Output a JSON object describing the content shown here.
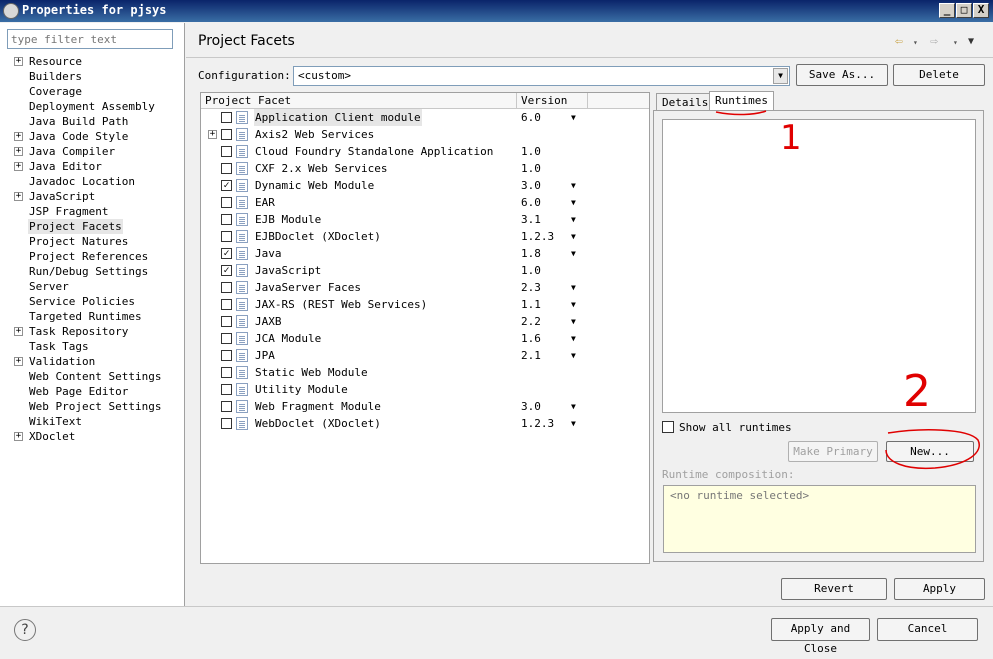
{
  "window": {
    "title": "Properties for pjsys",
    "minimize": "_",
    "maximize": "□",
    "close": "X"
  },
  "filter": {
    "placeholder": "type filter text"
  },
  "tree": [
    {
      "label": "Resource",
      "expandable": true
    },
    {
      "label": "Builders",
      "expandable": false
    },
    {
      "label": "Coverage",
      "expandable": false
    },
    {
      "label": "Deployment Assembly",
      "expandable": false
    },
    {
      "label": "Java Build Path",
      "expandable": false
    },
    {
      "label": "Java Code Style",
      "expandable": true
    },
    {
      "label": "Java Compiler",
      "expandable": true
    },
    {
      "label": "Java Editor",
      "expandable": true
    },
    {
      "label": "Javadoc Location",
      "expandable": false
    },
    {
      "label": "JavaScript",
      "expandable": true
    },
    {
      "label": "JSP Fragment",
      "expandable": false
    },
    {
      "label": "Project Facets",
      "expandable": false,
      "selected": true
    },
    {
      "label": "Project Natures",
      "expandable": false
    },
    {
      "label": "Project References",
      "expandable": false
    },
    {
      "label": "Run/Debug Settings",
      "expandable": false
    },
    {
      "label": "Server",
      "expandable": false
    },
    {
      "label": "Service Policies",
      "expandable": false
    },
    {
      "label": "Targeted Runtimes",
      "expandable": false
    },
    {
      "label": "Task Repository",
      "expandable": true
    },
    {
      "label": "Task Tags",
      "expandable": false
    },
    {
      "label": "Validation",
      "expandable": true
    },
    {
      "label": "Web Content Settings",
      "expandable": false
    },
    {
      "label": "Web Page Editor",
      "expandable": false
    },
    {
      "label": "Web Project Settings",
      "expandable": false
    },
    {
      "label": "WikiText",
      "expandable": false
    },
    {
      "label": "XDoclet",
      "expandable": true
    }
  ],
  "page": {
    "title": "Project Facets"
  },
  "config": {
    "label": "Configuration:",
    "value": "<custom>",
    "save_as": "Save As...",
    "delete": "Delete"
  },
  "facets": {
    "col_facet": "Project Facet",
    "col_version": "Version",
    "rows": [
      {
        "name": "Application Client module",
        "version": "6.0",
        "dropdown": true,
        "checked": false,
        "selected": true,
        "expandable": false
      },
      {
        "name": "Axis2 Web Services",
        "version": "",
        "dropdown": false,
        "checked": false,
        "expandable": true
      },
      {
        "name": "Cloud Foundry Standalone Application",
        "version": "1.0",
        "dropdown": false,
        "checked": false,
        "expandable": false
      },
      {
        "name": "CXF 2.x Web Services",
        "version": "1.0",
        "dropdown": false,
        "checked": false,
        "expandable": false
      },
      {
        "name": "Dynamic Web Module",
        "version": "3.0",
        "dropdown": true,
        "checked": true,
        "expandable": false
      },
      {
        "name": "EAR",
        "version": "6.0",
        "dropdown": true,
        "checked": false,
        "expandable": false
      },
      {
        "name": "EJB Module",
        "version": "3.1",
        "dropdown": true,
        "checked": false,
        "expandable": false
      },
      {
        "name": "EJBDoclet (XDoclet)",
        "version": "1.2.3",
        "dropdown": true,
        "checked": false,
        "expandable": false
      },
      {
        "name": "Java",
        "version": "1.8",
        "dropdown": true,
        "checked": true,
        "expandable": false
      },
      {
        "name": "JavaScript",
        "version": "1.0",
        "dropdown": false,
        "checked": true,
        "expandable": false
      },
      {
        "name": "JavaServer Faces",
        "version": "2.3",
        "dropdown": true,
        "checked": false,
        "expandable": false
      },
      {
        "name": "JAX-RS (REST Web Services)",
        "version": "1.1",
        "dropdown": true,
        "checked": false,
        "expandable": false
      },
      {
        "name": "JAXB",
        "version": "2.2",
        "dropdown": true,
        "checked": false,
        "expandable": false
      },
      {
        "name": "JCA Module",
        "version": "1.6",
        "dropdown": true,
        "checked": false,
        "expandable": false
      },
      {
        "name": "JPA",
        "version": "2.1",
        "dropdown": true,
        "checked": false,
        "expandable": false
      },
      {
        "name": "Static Web Module",
        "version": "",
        "dropdown": false,
        "checked": false,
        "expandable": false
      },
      {
        "name": "Utility Module",
        "version": "",
        "dropdown": false,
        "checked": false,
        "expandable": false
      },
      {
        "name": "Web Fragment Module",
        "version": "3.0",
        "dropdown": true,
        "checked": false,
        "expandable": false
      },
      {
        "name": "WebDoclet (XDoclet)",
        "version": "1.2.3",
        "dropdown": true,
        "checked": false,
        "expandable": false
      }
    ]
  },
  "tabs": {
    "details": "Details",
    "runtimes": "Runtimes"
  },
  "runtimes": {
    "show_all": "Show all runtimes",
    "make_primary": "Make Primary",
    "new": "New...",
    "composition_label": "Runtime composition:",
    "composition_value": "<no runtime selected>"
  },
  "actions": {
    "revert": "Revert",
    "apply": "Apply",
    "apply_close": "Apply and Close",
    "cancel": "Cancel"
  },
  "annotations": {
    "one": "1",
    "two": "2"
  },
  "colors": {
    "annotation": "#e00000",
    "titlebar": "#0a246a",
    "composition_bg": "#ffffe1"
  }
}
